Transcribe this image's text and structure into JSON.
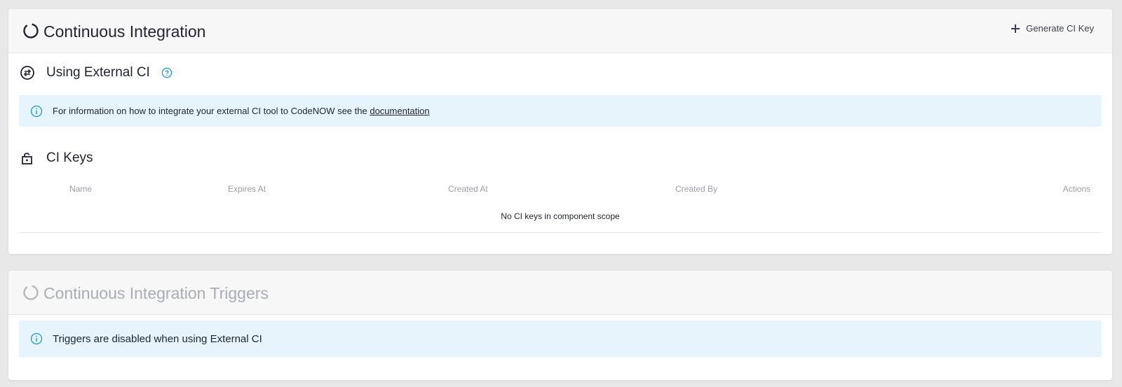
{
  "ci_card": {
    "title": "Continuous Integration",
    "generate_key_label": "Generate CI Key",
    "external_ci": {
      "title": "Using External CI",
      "info_text": "For information on how to integrate your external CI tool to CodeNOW see the ",
      "info_link": "documentation"
    },
    "ci_keys": {
      "title": "CI Keys",
      "columns": [
        "Name",
        "Expires At",
        "Created At",
        "Created By",
        "Actions"
      ],
      "empty_message": "No CI keys in component scope"
    }
  },
  "triggers_card": {
    "title": "Continuous Integration Triggers",
    "info_text": "Triggers are disabled when using External CI"
  },
  "colors": {
    "accent": "#1a9ad6",
    "info_bg": "#e6f4fc",
    "text": "#1f2430",
    "muted": "#9aa0aa"
  }
}
